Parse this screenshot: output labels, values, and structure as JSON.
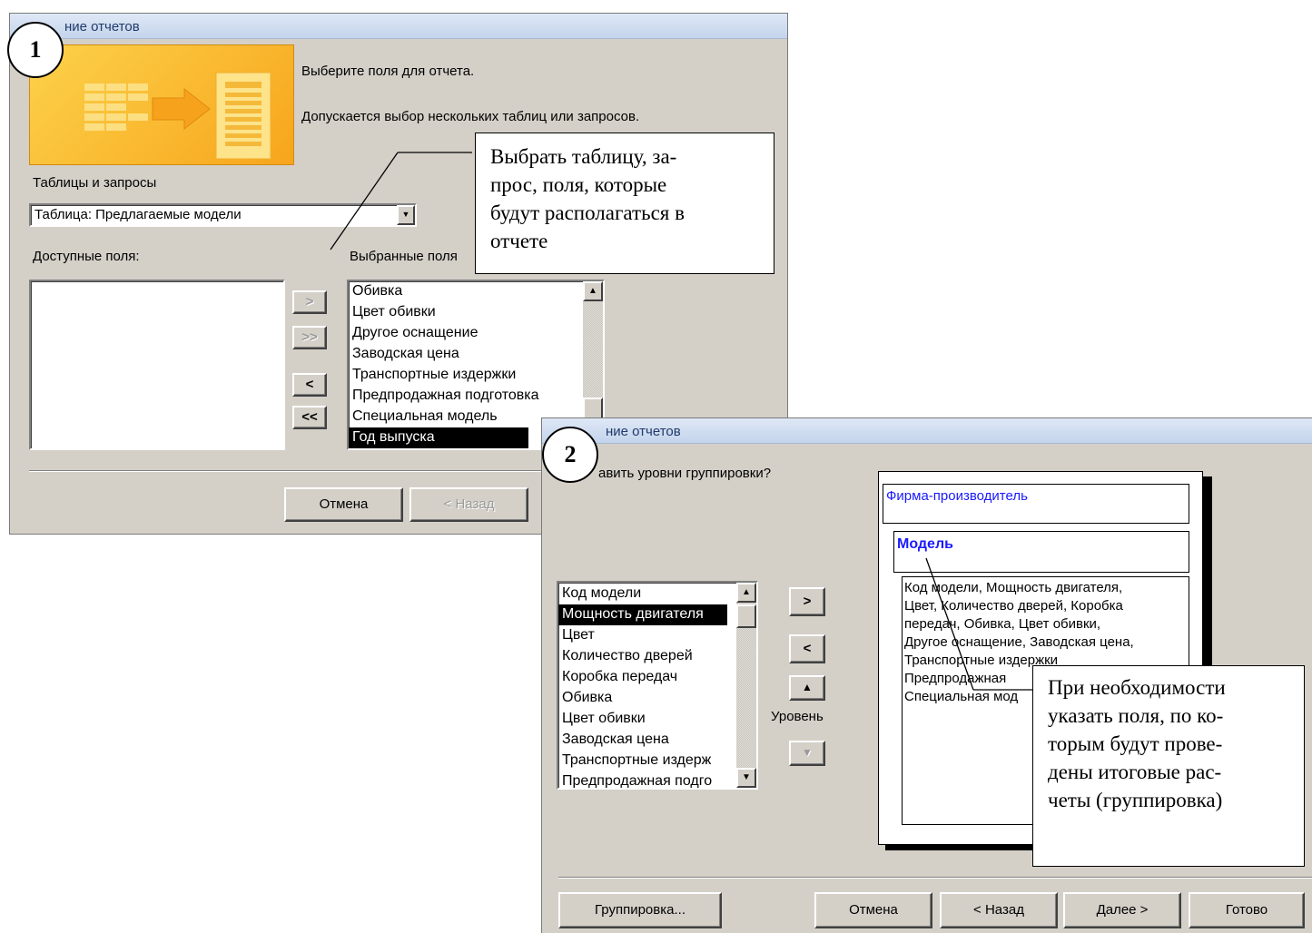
{
  "window1": {
    "badge": "1",
    "title": "ние отчетов",
    "instruction": "Выберите поля для отчета.",
    "note": "Допускается выбор нескольких таблиц или запросов.",
    "tables_label": "Таблицы и запросы",
    "tables_value": "Таблица: Предлагаемые модели",
    "available_label": "Доступные поля:",
    "selected_label": "Выбранные поля",
    "selected_fields": [
      "Обивка",
      "Цвет обивки",
      "Другое оснащение",
      "Заводская цена",
      "Транспортные издержки",
      "Предпродажная подготовка",
      "Специальная модель",
      "Год выпуска"
    ],
    "selected_active": "Год выпуска",
    "btn_add": ">",
    "btn_add_all": ">>",
    "btn_remove": "<",
    "btn_remove_all": "<<",
    "btn_cancel": "Отмена",
    "btn_back": "< Назад"
  },
  "window2": {
    "badge": "2",
    "title": "ние отчетов",
    "question": "авить уровни группировки?",
    "fields": [
      "Код модели",
      "Мощность двигателя",
      "Цвет",
      "Количество дверей",
      "Коробка передач",
      "Обивка",
      "Цвет обивки",
      "Заводская цена",
      "Транспортные издерж",
      "Предпродажная подго"
    ],
    "field_active": "Мощность двигателя",
    "btn_add": ">",
    "btn_remove": "<",
    "level_label": "Уровень",
    "preview_group1": "Фирма-производитель",
    "preview_group2": "Модель",
    "preview_detail_lines": [
      "Код модели, Мощность двигателя,",
      "Цвет, Количество дверей, Коробка",
      "передач, Обивка, Цвет обивки,",
      "Другое оснащение, Заводская цена,",
      "Транспортные издержки",
      "Предпродажная",
      "Специальная мод"
    ],
    "btn_grouping": "Группировка...",
    "btn_cancel": "Отмена",
    "btn_back": "< Назад",
    "btn_next": "Далее >",
    "btn_finish": "Готово"
  },
  "callout1_lines": [
    "Выбрать таблицу, за-",
    "прос, поля, которые",
    "будут располагаться в",
    "отчете"
  ],
  "callout2_lines": [
    "При необходимости",
    "указать поля, по ко-",
    "торым будут прове-",
    "дены итоговые рас-",
    "четы (группировка)"
  ]
}
